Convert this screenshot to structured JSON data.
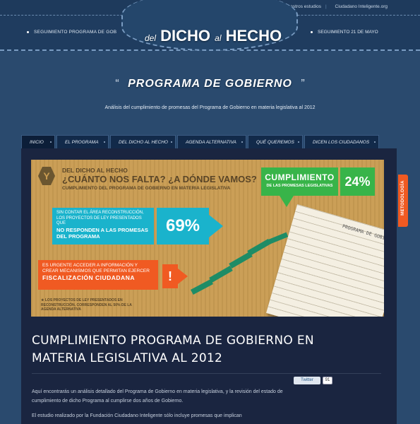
{
  "topbar": {
    "links": [
      "Sobre nuestros estudios",
      "Ciudadano Inteligente.org"
    ]
  },
  "header": {
    "nav_left": "Seguimiento Programa de Gob",
    "nav_right": "Seguimiento 21 de mayo",
    "logo_del": "del",
    "logo_dicho": "DICHO",
    "logo_al": "al",
    "logo_hecho": "HECHO"
  },
  "hero": {
    "title": "PROGRAMA DE GOBIERNO",
    "subtitle": "Análisis del cumplimiento de promesas del Programa de Gobierno en materia legislativa al 2012"
  },
  "tabs": [
    {
      "label": "Inicio",
      "active": true
    },
    {
      "label": "El Programa"
    },
    {
      "label": "Del dicho al hecho"
    },
    {
      "label": "Agenda alternativa"
    },
    {
      "label": "Qué queremos"
    },
    {
      "label": "Dicen los ciudadanos"
    }
  ],
  "side_tab": "Metodología",
  "banner": {
    "y_letter": "Y",
    "heading_small": "DEL DICHO AL HECHO",
    "heading_big": "¿CUÁNTO NOS FALTA? ¿A DÓNDE VAMOS?",
    "heading_sub": "CUMPLIMIENTO DEL PROGRAMA DE GOBIERNO EN MATERIA LEGISLATIVA",
    "green_title": "CUMPLIMIENTO",
    "green_sub": "DE LAS PROMESAS LEGISLATIVAS",
    "green_pct": "24%",
    "cyan_text_1": "SIN CONTAR EL ÁREA RECONSTRUCCIÓN, LOS PROYECTOS DE LEY PRESENTADOS QUE",
    "cyan_text_2": "NO RESPONDEN A LAS PROMESAS DEL PROGRAMA",
    "cyan_pct": "69%",
    "orange_text_1": "ES URGENTE ACCEDER A INFORMACIÓN Y CREAR MECANISMOS QUE PERMITAN EJERCER",
    "orange_text_2": "FISCALIZACIÓN CIUDADANA",
    "orange_mark": "!",
    "footnote": "★ LOS PROYECTOS DE LEY PRESENTADOS EN RECONSTRUCCIÓN, CORRESPONDEN AL 50% DE LA AGENDA ALTERNATIVA",
    "paper_title": "PROGRAMA DE GOBIERNO"
  },
  "article": {
    "title": "CUMPLIMIENTO PROGRAMA DE GOBIERNO EN MATERIA LEGISLATIVA AL 2012",
    "twitter_label": "Twitter",
    "twitter_count": "91",
    "paragraphs": [
      "Aquí encontrarás un análisis detallado del Programa de Gobierno en materia legislativa, y la revisión del estado de cumplimiento de dicho Programa al cumplirse dos años de Gobierno.",
      "El estudio realizado por la Fundación Ciudadano Inteligente sólo incluye promesas que implican"
    ]
  },
  "colors": {
    "background": "#2a4a6e",
    "green": "#38b449",
    "cyan": "#1ab3cc",
    "orange": "#f05a22",
    "panel": "#1a2540"
  }
}
